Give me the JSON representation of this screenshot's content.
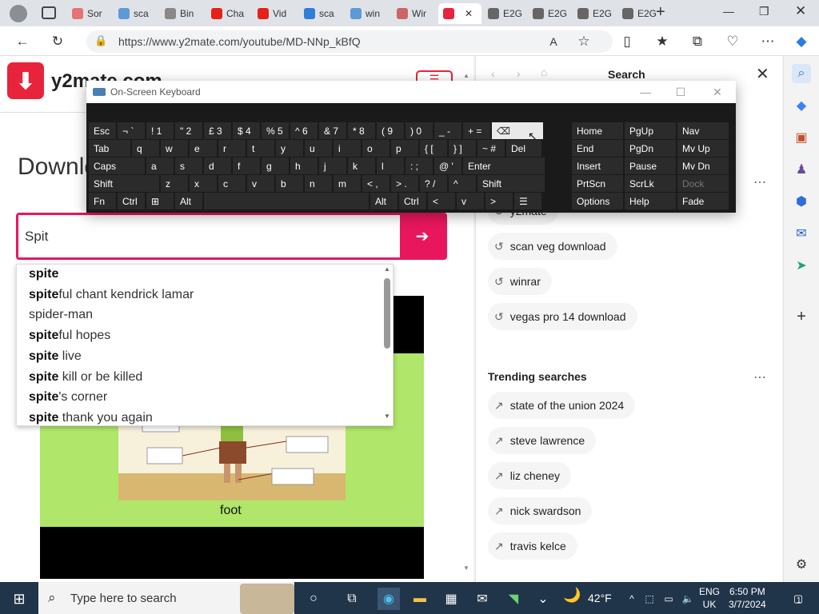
{
  "browser": {
    "tabs": [
      {
        "label": "Sor",
        "icon": "color-icon",
        "color": "#e57373"
      },
      {
        "label": "sca",
        "icon": "bing-icon",
        "color": "#5b9bd5"
      },
      {
        "label": "Bin",
        "icon": "search-icon",
        "color": "#888888"
      },
      {
        "label": "Cha",
        "icon": "youtube-icon",
        "color": "#e62117"
      },
      {
        "label": "Vid",
        "icon": "youtube-icon",
        "color": "#e62117"
      },
      {
        "label": "sca",
        "icon": "arrow-icon",
        "color": "#2f7ed8"
      },
      {
        "label": "win",
        "icon": "bing-icon",
        "color": "#5b9bd5"
      },
      {
        "label": "Wir",
        "icon": "grid-icon",
        "color": "#cc6666"
      },
      {
        "label": "",
        "icon": "y2mate-icon",
        "color": "#e8243c"
      },
      {
        "label": "E2G",
        "icon": "document-icon",
        "color": "#666666"
      },
      {
        "label": "E2G",
        "icon": "document-icon",
        "color": "#666666"
      },
      {
        "label": "E2G",
        "icon": "document-icon",
        "color": "#666666"
      },
      {
        "label": "E2G",
        "icon": "document-icon",
        "color": "#666666"
      }
    ],
    "url": "https://www.y2mate.com/youtube/MD-NNp_kBfQ"
  },
  "site": {
    "logo_text": "y2mate.com",
    "heading": "Downlo",
    "search_value": "Spit",
    "search_button_icon": "arrow-right-icon",
    "suggestions": [
      {
        "bold": "spite",
        "rest": ""
      },
      {
        "bold": "spite",
        "rest": "ful chant kendrick lamar"
      },
      {
        "bold": "",
        "rest": "spider-man"
      },
      {
        "bold": "spite",
        "rest": "ful hopes"
      },
      {
        "bold": "spite",
        "rest": " live"
      },
      {
        "bold": "spite",
        "rest": " kill or be killed"
      },
      {
        "bold": "spite",
        "rest": "'s corner"
      },
      {
        "bold": "spite",
        "rest": " thank you again"
      }
    ],
    "video_caption": "foot"
  },
  "search_pane": {
    "title": "Search",
    "recent": [
      "y2mate",
      "scan veg download",
      "winrar",
      "vegas pro 14 download"
    ],
    "trending_title": "Trending searches",
    "trending": [
      "state of the union 2024",
      "steve lawrence",
      "liz cheney",
      "nick swardson",
      "travis kelce"
    ]
  },
  "keyboard": {
    "title": "On-Screen Keyboard",
    "rows": [
      [
        {
          "l": "Esc",
          "w": 36
        },
        {
          "l": "¬ `",
          "w": 36
        },
        {
          "l": "! 1",
          "w": 36
        },
        {
          "l": "\" 2",
          "w": 36
        },
        {
          "l": "£ 3",
          "w": 36
        },
        {
          "l": "$ 4",
          "w": 36
        },
        {
          "l": "% 5",
          "w": 36
        },
        {
          "l": "^ 6",
          "w": 36
        },
        {
          "l": "& 7",
          "w": 36
        },
        {
          "l": "* 8",
          "w": 36
        },
        {
          "l": "( 9",
          "w": 36
        },
        {
          "l": ") 0",
          "w": 36
        },
        {
          "l": "_ -",
          "w": 36
        },
        {
          "l": "+ =",
          "w": 36
        },
        {
          "l": "⌫",
          "w": 66,
          "hl": true
        },
        {
          "l": "Home",
          "w": 66
        },
        {
          "l": "PgUp",
          "w": 66
        },
        {
          "l": "Nav",
          "w": 66
        }
      ],
      [
        {
          "l": "Tab",
          "w": 54
        },
        {
          "l": "q",
          "w": 36
        },
        {
          "l": "w",
          "w": 36
        },
        {
          "l": "e",
          "w": 36
        },
        {
          "l": "r",
          "w": 36
        },
        {
          "l": "t",
          "w": 36
        },
        {
          "l": "y",
          "w": 36
        },
        {
          "l": "u",
          "w": 36
        },
        {
          "l": "i",
          "w": 36
        },
        {
          "l": "o",
          "w": 36
        },
        {
          "l": "p",
          "w": 36
        },
        {
          "l": "{ [",
          "w": 36
        },
        {
          "l": "} ]",
          "w": 36
        },
        {
          "l": "~ #",
          "w": 36
        },
        {
          "l": "Del",
          "w": 46
        },
        {
          "l": "End",
          "w": 66
        },
        {
          "l": "PgDn",
          "w": 66
        },
        {
          "l": "Mv Up",
          "w": 66
        }
      ],
      [
        {
          "l": "Caps",
          "w": 72
        },
        {
          "l": "a",
          "w": 36
        },
        {
          "l": "s",
          "w": 36
        },
        {
          "l": "d",
          "w": 36
        },
        {
          "l": "f",
          "w": 36
        },
        {
          "l": "g",
          "w": 36
        },
        {
          "l": "h",
          "w": 36
        },
        {
          "l": "j",
          "w": 36
        },
        {
          "l": "k",
          "w": 36
        },
        {
          "l": "l",
          "w": 36
        },
        {
          "l": ": ;",
          "w": 36
        },
        {
          "l": "@ '",
          "w": 36
        },
        {
          "l": "Enter",
          "w": 104
        },
        {
          "l": "Insert",
          "w": 66
        },
        {
          "l": "Pause",
          "w": 66
        },
        {
          "l": "Mv Dn",
          "w": 66
        }
      ],
      [
        {
          "l": "Shift",
          "w": 90
        },
        {
          "l": "z",
          "w": 36
        },
        {
          "l": "x",
          "w": 36
        },
        {
          "l": "c",
          "w": 36
        },
        {
          "l": "v",
          "w": 36
        },
        {
          "l": "b",
          "w": 36
        },
        {
          "l": "n",
          "w": 36
        },
        {
          "l": "m",
          "w": 36
        },
        {
          "l": "< ,",
          "w": 36
        },
        {
          "l": "> .",
          "w": 36
        },
        {
          "l": "? /",
          "w": 36
        },
        {
          "l": "^",
          "w": 36
        },
        {
          "l": "Shift",
          "w": 86
        },
        {
          "l": "PrtScn",
          "w": 66
        },
        {
          "l": "ScrLk",
          "w": 66
        },
        {
          "l": "Dock",
          "w": 66,
          "dim": true
        }
      ],
      [
        {
          "l": "Fn",
          "w": 36
        },
        {
          "l": "Ctrl",
          "w": 36
        },
        {
          "l": "⊞",
          "w": 36
        },
        {
          "l": "Alt",
          "w": 36
        },
        {
          "l": "",
          "w": 208
        },
        {
          "l": "Alt",
          "w": 36
        },
        {
          "l": "Ctrl",
          "w": 36
        },
        {
          "l": "<",
          "w": 36
        },
        {
          "l": "v",
          "w": 36
        },
        {
          "l": ">",
          "w": 36
        },
        {
          "l": "☰",
          "w": 36
        },
        {
          "l": "Options",
          "w": 66
        },
        {
          "l": "Help",
          "w": 66
        },
        {
          "l": "Fade",
          "w": 66
        }
      ]
    ]
  },
  "taskbar": {
    "search_placeholder": "Type here to search",
    "weather": "42°F",
    "lang_line1": "ENG",
    "lang_line2": "UK",
    "time": "6:50 PM",
    "date": "3/7/2024",
    "notification_count": "1"
  }
}
